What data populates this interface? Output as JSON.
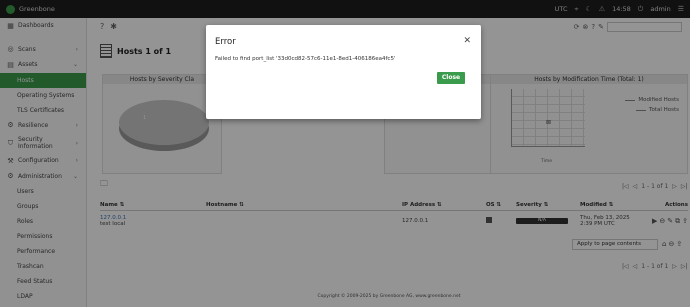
{
  "topbar": {
    "brand": "Greenbone",
    "timezone": "UTC",
    "time": "14:58",
    "user": "admin"
  },
  "sidebar": {
    "dashboards": "Dashboards",
    "scans": "Scans",
    "assets": "Assets",
    "asset_items": [
      "Hosts",
      "Operating Systems",
      "TLS Certificates"
    ],
    "resilience": "Resilience",
    "security_information_1": "Security",
    "security_information_2": "Information",
    "configuration": "Configuration",
    "administration": "Administration",
    "admin_items": [
      "Users",
      "Groups",
      "Roles",
      "Permissions",
      "Performance",
      "Trashcan",
      "Feed Status",
      "LDAP"
    ]
  },
  "page": {
    "title": "Hosts 1 of 1"
  },
  "charts": {
    "severity_title": "Hosts by Severity Cla",
    "modtime_title": "Hosts by Modification Time (Total: 1)",
    "legend_modified": "Modified Hosts",
    "legend_total": "Total Hosts",
    "xlabel": "Time"
  },
  "pager": {
    "top": "1 - 1 of 1",
    "bottom": "1 - 1 of 1"
  },
  "table": {
    "headers": [
      "Name ⇅",
      "Hostname ⇅",
      "IP Address ⇅",
      "OS ⇅",
      "Severity ⇅",
      "Modified ⇅",
      "Actions"
    ],
    "rows": [
      {
        "name": "127.0.0.1",
        "comment": "test local",
        "ip": "127.0.0.1",
        "severity": "N/A",
        "modified_1": "Thu, Feb 13, 2025",
        "modified_2": "2:39 PM UTC"
      }
    ]
  },
  "apply": "Apply to page contents",
  "footer": "Copyright © 2009-2025 by Greenbone AG, www.greenbone.net",
  "modal": {
    "title": "Error",
    "message": "Failed to find port_list '33d0cd82-57c6-11e1-8ed1-406186ea4fc5'",
    "close_label": "Close"
  },
  "colors": {
    "accent": "#3b9b4d",
    "topbar": "#1e1e1e"
  }
}
